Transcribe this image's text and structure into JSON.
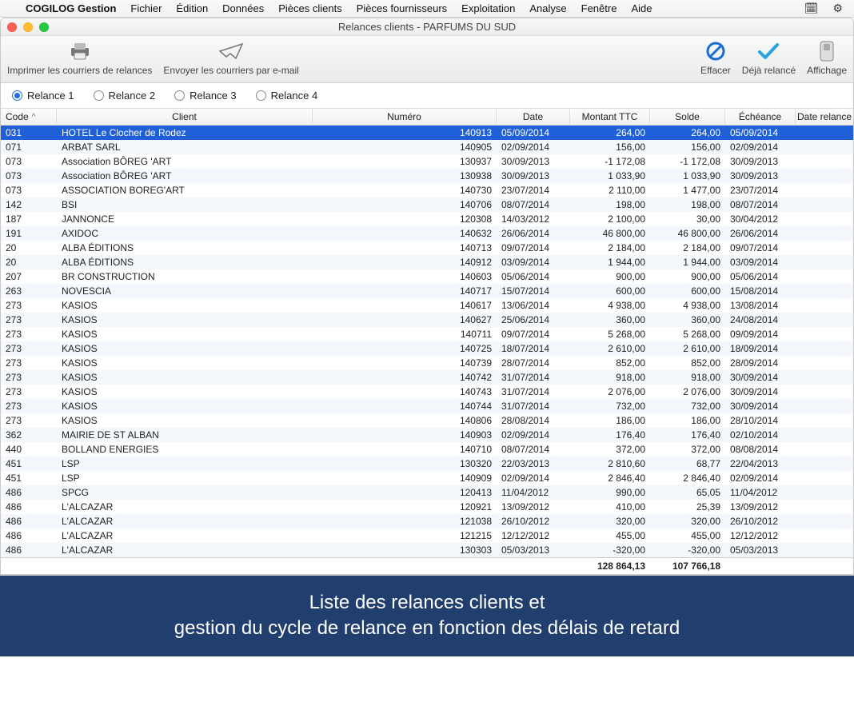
{
  "menubar": {
    "app": "COGILOG Gestion",
    "items": [
      "Fichier",
      "Édition",
      "Données",
      "Pièces clients",
      "Pièces fournisseurs",
      "Exploitation",
      "Analyse",
      "Fenêtre",
      "Aide"
    ]
  },
  "window": {
    "title": "Relances clients - PARFUMS DU SUD"
  },
  "toolbar": {
    "print": "Imprimer les courriers de relances",
    "email": "Envoyer les courriers par e-mail",
    "clear": "Effacer",
    "done": "Déjà relancé",
    "display": "Affichage"
  },
  "radios": [
    "Relance 1",
    "Relance 2",
    "Relance 3",
    "Relance 4"
  ],
  "radio_selected": 0,
  "columns": [
    "Code",
    "Client",
    "Numéro",
    "Date",
    "Montant TTC",
    "Solde",
    "Échéance",
    "Date relance"
  ],
  "rows": [
    {
      "code": "031",
      "client": "HOTEL Le Clocher de Rodez",
      "num": "140913",
      "date": "05/09/2014",
      "mtc": "264,00",
      "solde": "264,00",
      "ech": "05/09/2014",
      "drel": "",
      "sel": true
    },
    {
      "code": "071",
      "client": "ARBAT SARL",
      "num": "140905",
      "date": "02/09/2014",
      "mtc": "156,00",
      "solde": "156,00",
      "ech": "02/09/2014",
      "drel": ""
    },
    {
      "code": "073",
      "client": "Association BÔREG 'ART",
      "num": "130937",
      "date": "30/09/2013",
      "mtc": "-1 172,08",
      "solde": "-1 172,08",
      "ech": "30/09/2013",
      "drel": ""
    },
    {
      "code": "073",
      "client": "Association BÔREG 'ART",
      "num": "130938",
      "date": "30/09/2013",
      "mtc": "1 033,90",
      "solde": "1 033,90",
      "ech": "30/09/2013",
      "drel": ""
    },
    {
      "code": "073",
      "client": "ASSOCIATION BOREG'ART",
      "num": "140730",
      "date": "23/07/2014",
      "mtc": "2 110,00",
      "solde": "1 477,00",
      "ech": "23/07/2014",
      "drel": ""
    },
    {
      "code": "142",
      "client": "BSI",
      "num": "140706",
      "date": "08/07/2014",
      "mtc": "198,00",
      "solde": "198,00",
      "ech": "08/07/2014",
      "drel": ""
    },
    {
      "code": "187",
      "client": "JANNONCE",
      "num": "120308",
      "date": "14/03/2012",
      "mtc": "2 100,00",
      "solde": "30,00",
      "ech": "30/04/2012",
      "drel": ""
    },
    {
      "code": "191",
      "client": "AXIDOC",
      "num": "140632",
      "date": "26/06/2014",
      "mtc": "46 800,00",
      "solde": "46 800,00",
      "ech": "26/06/2014",
      "drel": ""
    },
    {
      "code": "20",
      "client": "ALBA ÉDITIONS",
      "num": "140713",
      "date": "09/07/2014",
      "mtc": "2 184,00",
      "solde": "2 184,00",
      "ech": "09/07/2014",
      "drel": ""
    },
    {
      "code": "20",
      "client": "ALBA ÉDITIONS",
      "num": "140912",
      "date": "03/09/2014",
      "mtc": "1 944,00",
      "solde": "1 944,00",
      "ech": "03/09/2014",
      "drel": ""
    },
    {
      "code": "207",
      "client": "BR CONSTRUCTION",
      "num": "140603",
      "date": "05/06/2014",
      "mtc": "900,00",
      "solde": "900,00",
      "ech": "05/06/2014",
      "drel": ""
    },
    {
      "code": "263",
      "client": "NOVESCIA",
      "num": "140717",
      "date": "15/07/2014",
      "mtc": "600,00",
      "solde": "600,00",
      "ech": "15/08/2014",
      "drel": ""
    },
    {
      "code": "273",
      "client": "KASIOS",
      "num": "140617",
      "date": "13/06/2014",
      "mtc": "4 938,00",
      "solde": "4 938,00",
      "ech": "13/08/2014",
      "drel": ""
    },
    {
      "code": "273",
      "client": "KASIOS",
      "num": "140627",
      "date": "25/06/2014",
      "mtc": "360,00",
      "solde": "360,00",
      "ech": "24/08/2014",
      "drel": ""
    },
    {
      "code": "273",
      "client": "KASIOS",
      "num": "140711",
      "date": "09/07/2014",
      "mtc": "5 268,00",
      "solde": "5 268,00",
      "ech": "09/09/2014",
      "drel": ""
    },
    {
      "code": "273",
      "client": "KASIOS",
      "num": "140725",
      "date": "18/07/2014",
      "mtc": "2 610,00",
      "solde": "2 610,00",
      "ech": "18/09/2014",
      "drel": ""
    },
    {
      "code": "273",
      "client": "KASIOS",
      "num": "140739",
      "date": "28/07/2014",
      "mtc": "852,00",
      "solde": "852,00",
      "ech": "28/09/2014",
      "drel": ""
    },
    {
      "code": "273",
      "client": "KASIOS",
      "num": "140742",
      "date": "31/07/2014",
      "mtc": "918,00",
      "solde": "918,00",
      "ech": "30/09/2014",
      "drel": ""
    },
    {
      "code": "273",
      "client": "KASIOS",
      "num": "140743",
      "date": "31/07/2014",
      "mtc": "2 076,00",
      "solde": "2 076,00",
      "ech": "30/09/2014",
      "drel": ""
    },
    {
      "code": "273",
      "client": "KASIOS",
      "num": "140744",
      "date": "31/07/2014",
      "mtc": "732,00",
      "solde": "732,00",
      "ech": "30/09/2014",
      "drel": ""
    },
    {
      "code": "273",
      "client": "KASIOS",
      "num": "140806",
      "date": "28/08/2014",
      "mtc": "186,00",
      "solde": "186,00",
      "ech": "28/10/2014",
      "drel": ""
    },
    {
      "code": "362",
      "client": "MAIRIE  DE ST ALBAN",
      "num": "140903",
      "date": "02/09/2014",
      "mtc": "176,40",
      "solde": "176,40",
      "ech": "02/10/2014",
      "drel": ""
    },
    {
      "code": "440",
      "client": "BOLLAND ENERGIES",
      "num": "140710",
      "date": "08/07/2014",
      "mtc": "372,00",
      "solde": "372,00",
      "ech": "08/08/2014",
      "drel": ""
    },
    {
      "code": "451",
      "client": "LSP",
      "num": "130320",
      "date": "22/03/2013",
      "mtc": "2 810,60",
      "solde": "68,77",
      "ech": "22/04/2013",
      "drel": ""
    },
    {
      "code": "451",
      "client": "LSP",
      "num": "140909",
      "date": "02/09/2014",
      "mtc": "2 846,40",
      "solde": "2 846,40",
      "ech": "02/09/2014",
      "drel": ""
    },
    {
      "code": "486",
      "client": "SPCG",
      "num": "120413",
      "date": "11/04/2012",
      "mtc": "990,00",
      "solde": "65,05",
      "ech": "11/04/2012",
      "drel": ""
    },
    {
      "code": "486",
      "client": "L'ALCAZAR",
      "num": "120921",
      "date": "13/09/2012",
      "mtc": "410,00",
      "solde": "25,39",
      "ech": "13/09/2012",
      "drel": ""
    },
    {
      "code": "486",
      "client": "L'ALCAZAR",
      "num": "121038",
      "date": "26/10/2012",
      "mtc": "320,00",
      "solde": "320,00",
      "ech": "26/10/2012",
      "drel": ""
    },
    {
      "code": "486",
      "client": "L'ALCAZAR",
      "num": "121215",
      "date": "12/12/2012",
      "mtc": "455,00",
      "solde": "455,00",
      "ech": "12/12/2012",
      "drel": ""
    },
    {
      "code": "486",
      "client": "L'ALCAZAR",
      "num": "130303",
      "date": "05/03/2013",
      "mtc": "-320,00",
      "solde": "-320,00",
      "ech": "05/03/2013",
      "drel": ""
    }
  ],
  "totals": {
    "mtc": "128 864,13",
    "solde": "107 766,18"
  },
  "caption": {
    "line1": "Liste des relances clients et",
    "line2": "gestion du cycle de relance en fonction des délais de retard"
  }
}
